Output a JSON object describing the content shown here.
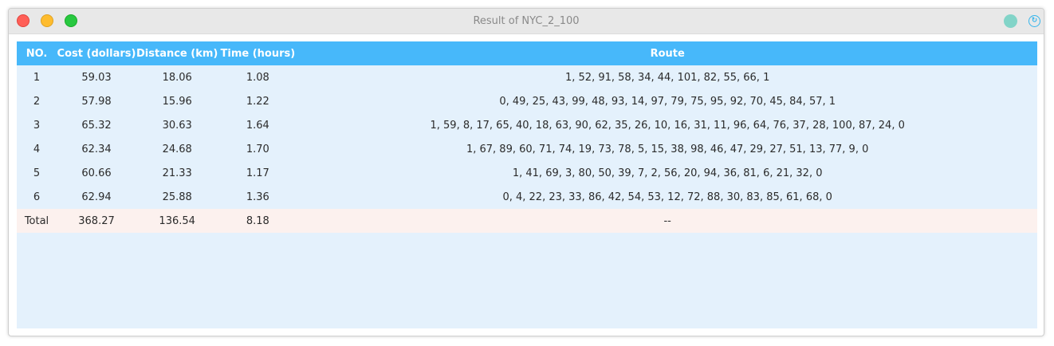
{
  "window": {
    "title": "Result of NYC_2_100"
  },
  "table": {
    "headers": {
      "no": "NO.",
      "cost": "Cost (dollars)",
      "distance": "Distance (km)",
      "time": "Time (hours)",
      "route": "Route"
    },
    "rows": [
      {
        "no": "1",
        "cost": "59.03",
        "distance": "18.06",
        "time": "1.08",
        "route": "1, 52, 91, 58, 34, 44, 101, 82, 55, 66, 1"
      },
      {
        "no": "2",
        "cost": "57.98",
        "distance": "15.96",
        "time": "1.22",
        "route": "0, 49, 25, 43, 99, 48, 93, 14, 97, 79, 75, 95, 92, 70, 45, 84, 57, 1"
      },
      {
        "no": "3",
        "cost": "65.32",
        "distance": "30.63",
        "time": "1.64",
        "route": "1, 59, 8, 17, 65, 40, 18, 63, 90, 62, 35, 26, 10, 16, 31, 11, 96, 64, 76, 37, 28, 100, 87, 24, 0"
      },
      {
        "no": "4",
        "cost": "62.34",
        "distance": "24.68",
        "time": "1.70",
        "route": "1, 67, 89, 60, 71, 74, 19, 73, 78, 5, 15, 38, 98, 46, 47, 29, 27, 51, 13, 77, 9, 0"
      },
      {
        "no": "5",
        "cost": "60.66",
        "distance": "21.33",
        "time": "1.17",
        "route": "1, 41, 69, 3, 80, 50, 39, 7, 2, 56, 20, 94, 36, 81, 6, 21, 32, 0"
      },
      {
        "no": "6",
        "cost": "62.94",
        "distance": "25.88",
        "time": "1.36",
        "route": "0, 4, 22, 23, 33, 86, 42, 54, 53, 12, 72, 88, 30, 83, 85, 61, 68, 0"
      }
    ],
    "total": {
      "no": "Total",
      "cost": "368.27",
      "distance": "136.54",
      "time": "8.18",
      "route": "--"
    }
  },
  "colors": {
    "header": "#47b8fa",
    "body": "#e4f1fc",
    "total_row": "#fcf1ee"
  }
}
